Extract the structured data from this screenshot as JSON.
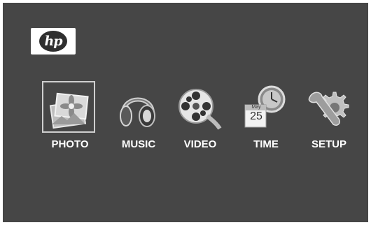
{
  "brand": {
    "logo_text": "hp",
    "logo_icon": "hp-logo"
  },
  "menu": {
    "items": [
      {
        "label": "PHOTO",
        "icon": "photo-icon",
        "selected": true
      },
      {
        "label": "MUSIC",
        "icon": "headphones-icon",
        "selected": false
      },
      {
        "label": "VIDEO",
        "icon": "film-reel-icon",
        "selected": false
      },
      {
        "label": "TIME",
        "icon": "clock-calendar-icon",
        "selected": false
      },
      {
        "label": "SETUP",
        "icon": "wrench-gear-icon",
        "selected": false
      }
    ],
    "time_icon": {
      "calendar_month": "May",
      "calendar_day": "25"
    }
  },
  "colors": {
    "background": "#464646",
    "text": "#ffffff",
    "selection_border": "#cfcfcf"
  }
}
